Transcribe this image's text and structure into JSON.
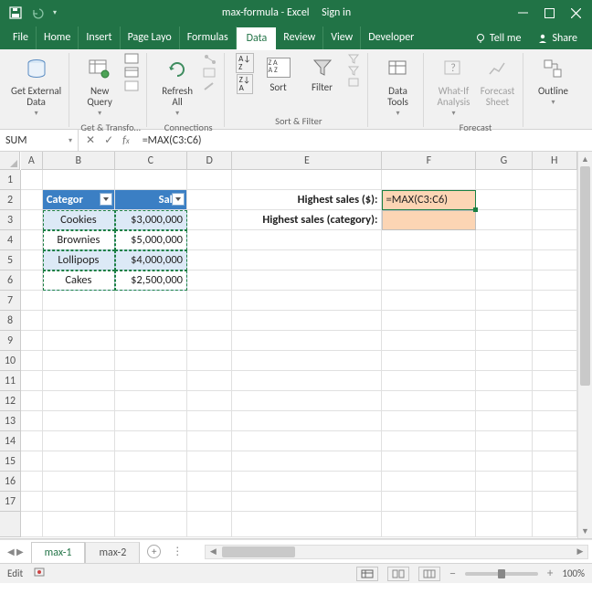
{
  "title": {
    "doc": "max-formula",
    "app": "Excel",
    "signin": "Sign in"
  },
  "tabs": [
    "File",
    "Home",
    "Insert",
    "Page Layo",
    "Formulas",
    "Data",
    "Review",
    "View",
    "Developer"
  ],
  "tellme": "Tell me",
  "share": "Share",
  "ribbon": {
    "getExternal": "Get External\nData",
    "newQuery": "New\nQuery",
    "getTransform": "Get & Transfo…",
    "refreshAll": "Refresh\nAll",
    "connections": "Connections",
    "sort": "Sort",
    "filter": "Filter",
    "sortFilter": "Sort & Filter",
    "dataTools": "Data\nTools",
    "whatIf": "What-If\nAnalysis",
    "forecastSheet": "Forecast\nSheet",
    "forecast": "Forecast",
    "outline": "Outline"
  },
  "formulaBar": {
    "name": "SUM",
    "formula": "=MAX(C3:C6)"
  },
  "cols": [
    "A",
    "B",
    "C",
    "D",
    "E",
    "F",
    "G",
    "H"
  ],
  "rows": [
    "1",
    "2",
    "3",
    "4",
    "5",
    "6",
    "7",
    "8",
    "9",
    "10",
    "11",
    "12",
    "13",
    "14",
    "15",
    "16",
    "17"
  ],
  "table": {
    "headers": [
      "Categor",
      "Sales"
    ],
    "data": [
      [
        "Cookies",
        "$3,000,000"
      ],
      [
        "Brownies",
        "$5,000,000"
      ],
      [
        "Lollipops",
        "$4,000,000"
      ],
      [
        "Cakes",
        "$2,500,000"
      ]
    ]
  },
  "labels": {
    "highestDollar": "Highest sales ($):",
    "highestCat": "Highest sales (category):"
  },
  "editFormula": "=MAX(C3:C6)",
  "sheets": {
    "s1": "max-1",
    "s2": "max-2"
  },
  "status": {
    "mode": "Edit",
    "zoom": "100%"
  },
  "chart_data": null
}
